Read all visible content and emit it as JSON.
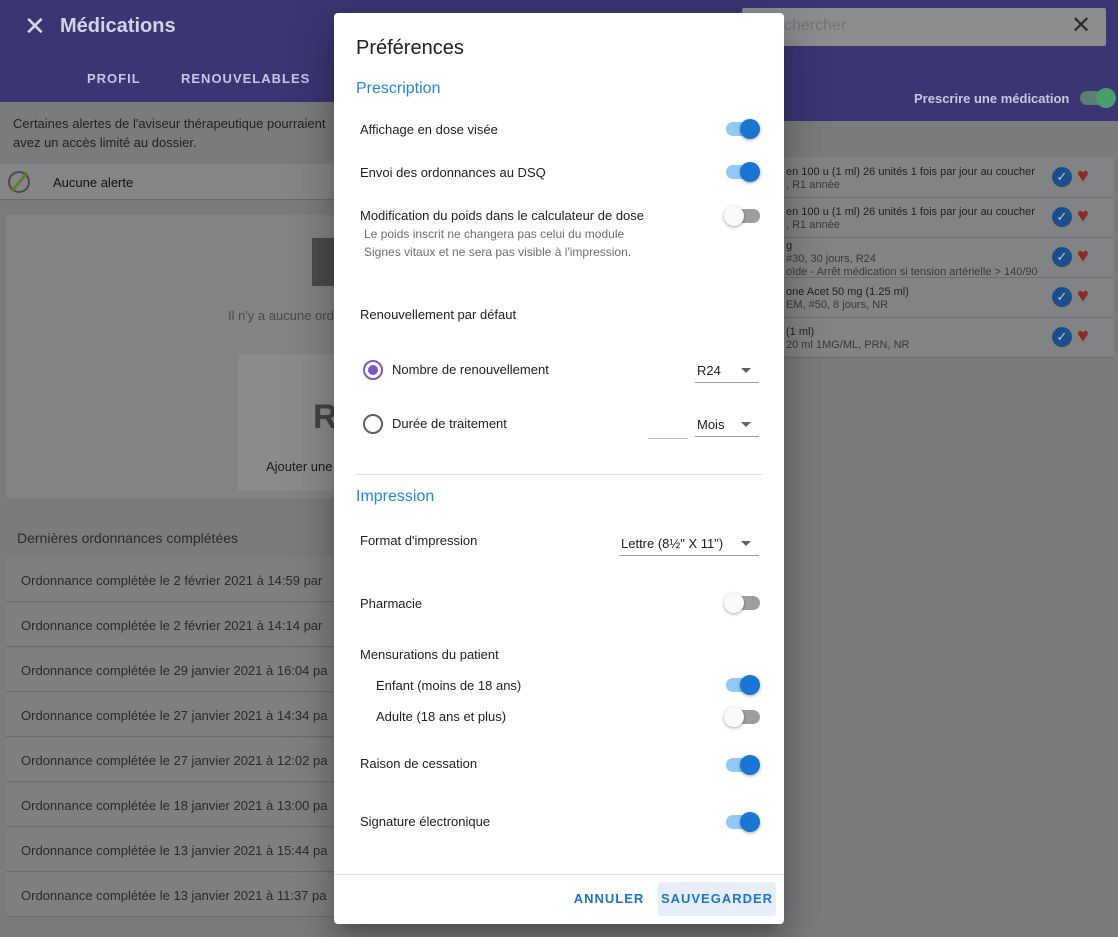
{
  "app": {
    "close_glyph": "✕",
    "title": "Médications",
    "tabs": [
      "PROFIL",
      "RENOUVELABLES"
    ],
    "alert_notice": "Certaines alertes de l'aviseur thérapeutique pourraient avez un accès limité au dossier.",
    "alert_row_label": "Aucune alerte",
    "empty_text": "Il n'y a aucune ord",
    "add_label": "Ajouter une",
    "rx_glyph": "R",
    "completed_title": "Dernières ordonnances complétées",
    "completed_rows": [
      "Ordonnance complétée le 2 février 2021 à 14:59 par",
      "Ordonnance complétée le 2 février 2021 à 14:14 par",
      "Ordonnance complétée le 29 janvier 2021 à 16:04 pa",
      "Ordonnance complétée le 27 janvier 2021 à 14:34 pa",
      "Ordonnance complétée le 27 janvier 2021 à 12:02 pa",
      "Ordonnance complétée le 18 janvier 2021 à 13:00 pa",
      "Ordonnance complétée le 13 janvier 2021 à 15:44 pa",
      "Ordonnance complétée le 13 janvier 2021 à 11:37 pa"
    ],
    "search_placeholder": "chercher",
    "search_close_glyph": "✕",
    "prescribe_label": "Prescrire une médication",
    "medications": [
      {
        "line1": "en 100 u (1 ml) 26 unités 1 fois par jour au coucher",
        "line2": ", R1 année"
      },
      {
        "line1": "en 100 u (1 ml) 26 unités 1 fois par jour au coucher",
        "line2": ", R1 année"
      },
      {
        "line1": "g",
        "line2": "#30, 30 jours, R24"
      },
      {
        "line1": "one Acet 50 mg (1.25 ml)",
        "line2": "EM, #50, 8 jours, NR"
      },
      {
        "line1": "(1 ml)",
        "line2": "20 ml 1MG/ML, PRN, NR"
      }
    ],
    "med_extra_note": "oïde - Arrêt médication si tension artérielle > 140/90",
    "check_glyph": "✓",
    "heart_glyph": "♥"
  },
  "dialog": {
    "title": "Préférences",
    "prescription": {
      "section_title": "Prescription",
      "dose_display": {
        "label": "Affichage en dose visée",
        "on": true
      },
      "dsq": {
        "label": "Envoi des ordonnances au DSQ",
        "on": true
      },
      "weight_mod": {
        "label": "Modification du poids dans le calculateur de dose",
        "on": false,
        "helper": "Le poids inscrit ne changera pas celui du module Signes vitaux et ne sera pas visible à l'impression."
      },
      "renewal_title": "Renouvellement par défaut",
      "renewal_count": {
        "label": "Nombre de renouvellement",
        "selected": true,
        "value": "R24"
      },
      "treatment_duration": {
        "label": "Durée de traitement",
        "selected": false,
        "unit": "Mois"
      }
    },
    "impression": {
      "section_title": "Impression",
      "format": {
        "label": "Format d'impression",
        "value": "Lettre (8½\" X 11\")"
      },
      "pharmacy": {
        "label": "Pharmacie",
        "on": false
      },
      "measurements_title": "Mensurations du patient",
      "child": {
        "label": "Enfant (moins de 18 ans)",
        "on": true
      },
      "adult": {
        "label": "Adulte (18 ans et plus)",
        "on": false
      },
      "cessation": {
        "label": "Raison de cessation",
        "on": true
      },
      "signature": {
        "label": "Signature électronique",
        "on": true
      }
    },
    "buttons": {
      "cancel": "ANNULER",
      "save": "SAUVEGARDER"
    }
  },
  "colors": {
    "accent": "#1e88e5",
    "toggle_on": "#1976d2",
    "header": "#3b3573",
    "radio": "#7e57c2"
  }
}
